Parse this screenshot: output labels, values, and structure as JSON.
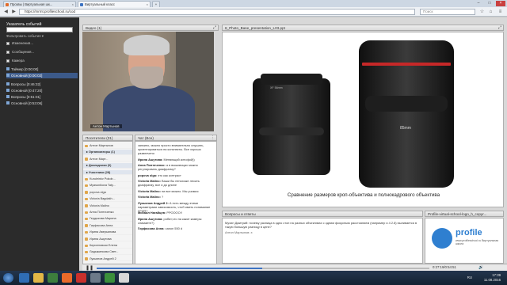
{
  "browser": {
    "tabs": [
      {
        "label": "Прозвы | Виртуальная шк..."
      },
      {
        "label": "Виртуальный класс"
      }
    ],
    "url": "https://mrmt.profileschool.ru/cod",
    "search_placeholder": "Поиск"
  },
  "sidebar": {
    "title": "Указатель событий",
    "filter_label": "Фильтровать события ▾",
    "checkboxes": [
      {
        "label": "Изменения..."
      },
      {
        "label": "Сообщения..."
      },
      {
        "label": "Камера"
      }
    ],
    "events": [
      {
        "label": "Таймер [0:00:00]",
        "highlight": false
      },
      {
        "label": "Основной [0:00:02]",
        "highlight": true
      },
      {
        "label": "Вопросы [0:46:32]",
        "highlight": false
      },
      {
        "label": "Основной [0:47:20]",
        "highlight": false
      },
      {
        "label": "Вопросы [0:51:01]",
        "highlight": false
      },
      {
        "label": "Основной [0:53:06]",
        "highlight": false
      }
    ]
  },
  "video": {
    "header": "Видео (1)",
    "caption": "Антон Мартынов"
  },
  "attendees": {
    "header": "Посетители (31)",
    "rows": [
      {
        "label": "Антон Мартынов",
        "group": false
      },
      {
        "label": "Организаторы (1)",
        "group": true
      },
      {
        "label": "Антон Март...",
        "group": false
      },
      {
        "label": "Докладчики (0)",
        "group": true
      },
      {
        "label": "Участники (28)",
        "group": true
      },
      {
        "label": "Kuruleinkv Pokob...",
        "group": false
      },
      {
        "label": "Myassnikova Taty...",
        "group": false
      },
      {
        "label": "popova olga",
        "group": false
      },
      {
        "label": "Victoria Bagdakh...",
        "group": false
      },
      {
        "label": "Victoria Malino",
        "group": false
      },
      {
        "label": "Анна Поптяченко",
        "group": false
      },
      {
        "label": "Гердыкова Марина",
        "group": false
      },
      {
        "label": "Гирфасова Анна",
        "group": false
      },
      {
        "label": "Ирина Аверьянова",
        "group": false
      },
      {
        "label": "Ирина Ашутова",
        "group": false
      },
      {
        "label": "Кирилловски Елена",
        "group": false
      },
      {
        "label": "Ладыжинкова Свет...",
        "group": false
      },
      {
        "label": "Лукьянов Андрей 2",
        "group": false
      }
    ]
  },
  "chat": {
    "header": "Чат (Все)",
    "messages": [
      {
        "author": "",
        "text": "занкино, можно просто внимательно слушать, ориентироваться на конспекты. Все хорошо развлечено"
      },
      {
        "author": "Ирина Ашутова:",
        "text": "Меняющий китофой))"
      },
      {
        "author": "Анна Поптяченко:",
        "text": "а в вышивицах можно регулировать диафрагму?"
      },
      {
        "author": "popova olga:",
        "text": "это как контраст"
      },
      {
        "author": "Victoria Malino:",
        "text": "Ваши бы непохоже лесать диафрагму, все и до длине"
      },
      {
        "author": "Victoria Malino:",
        "text": "пи все можно. Мы учимся"
      },
      {
        "author": "Victoria Malino:",
        "text": "?"
      },
      {
        "author": "Лукьянов Андрей 2:",
        "text": "А есть между этими параметрами зависимость, чтоб иметь понимание ГРИП?"
      },
      {
        "author": "Михаил Нагайцев:",
        "text": "РРОООО!!"
      },
      {
        "author": "Ирина Ашутова:",
        "text": "робят,что на какит камеры снимаете?)"
      },
      {
        "author": "Гирфасова Анна:",
        "text": "canon 550 d"
      }
    ]
  },
  "presentation": {
    "header": "8_Photo_Base_presentation_L03.ppt",
    "caption": "Сравнение размеров кроп-объектива и полнокадрового объектива",
    "lens_left_label": "XF 56mm",
    "lens_right_label": "85mm"
  },
  "questions": {
    "header": "Вопросы и ответы",
    "text": "Мухин Дмитрий: почему разница в одно стоп на разных объективах с одним фокусным расстоянием (например и 4 2.8) выливается в такую большую разницу в цене?",
    "reply": "Антон Мартынов: э"
  },
  "logo_panel": {
    "header": "Profile-virtual-school-logo_h_copyr...",
    "logo_word": "profile",
    "logo_sub": "www.profileschool.ru Виртуальная школа"
  },
  "playback": {
    "time": "0:27:19/0:54:51",
    "progress": 0.497
  },
  "taskbar": {
    "time": "17:39",
    "date": "11.08.2016",
    "lang": "RU"
  },
  "colors": {
    "accent": "#3d73c2",
    "sidebar_bg": "#2b2b2b",
    "highlight": "#3c5a8a",
    "logo": "#2f7fd0"
  }
}
